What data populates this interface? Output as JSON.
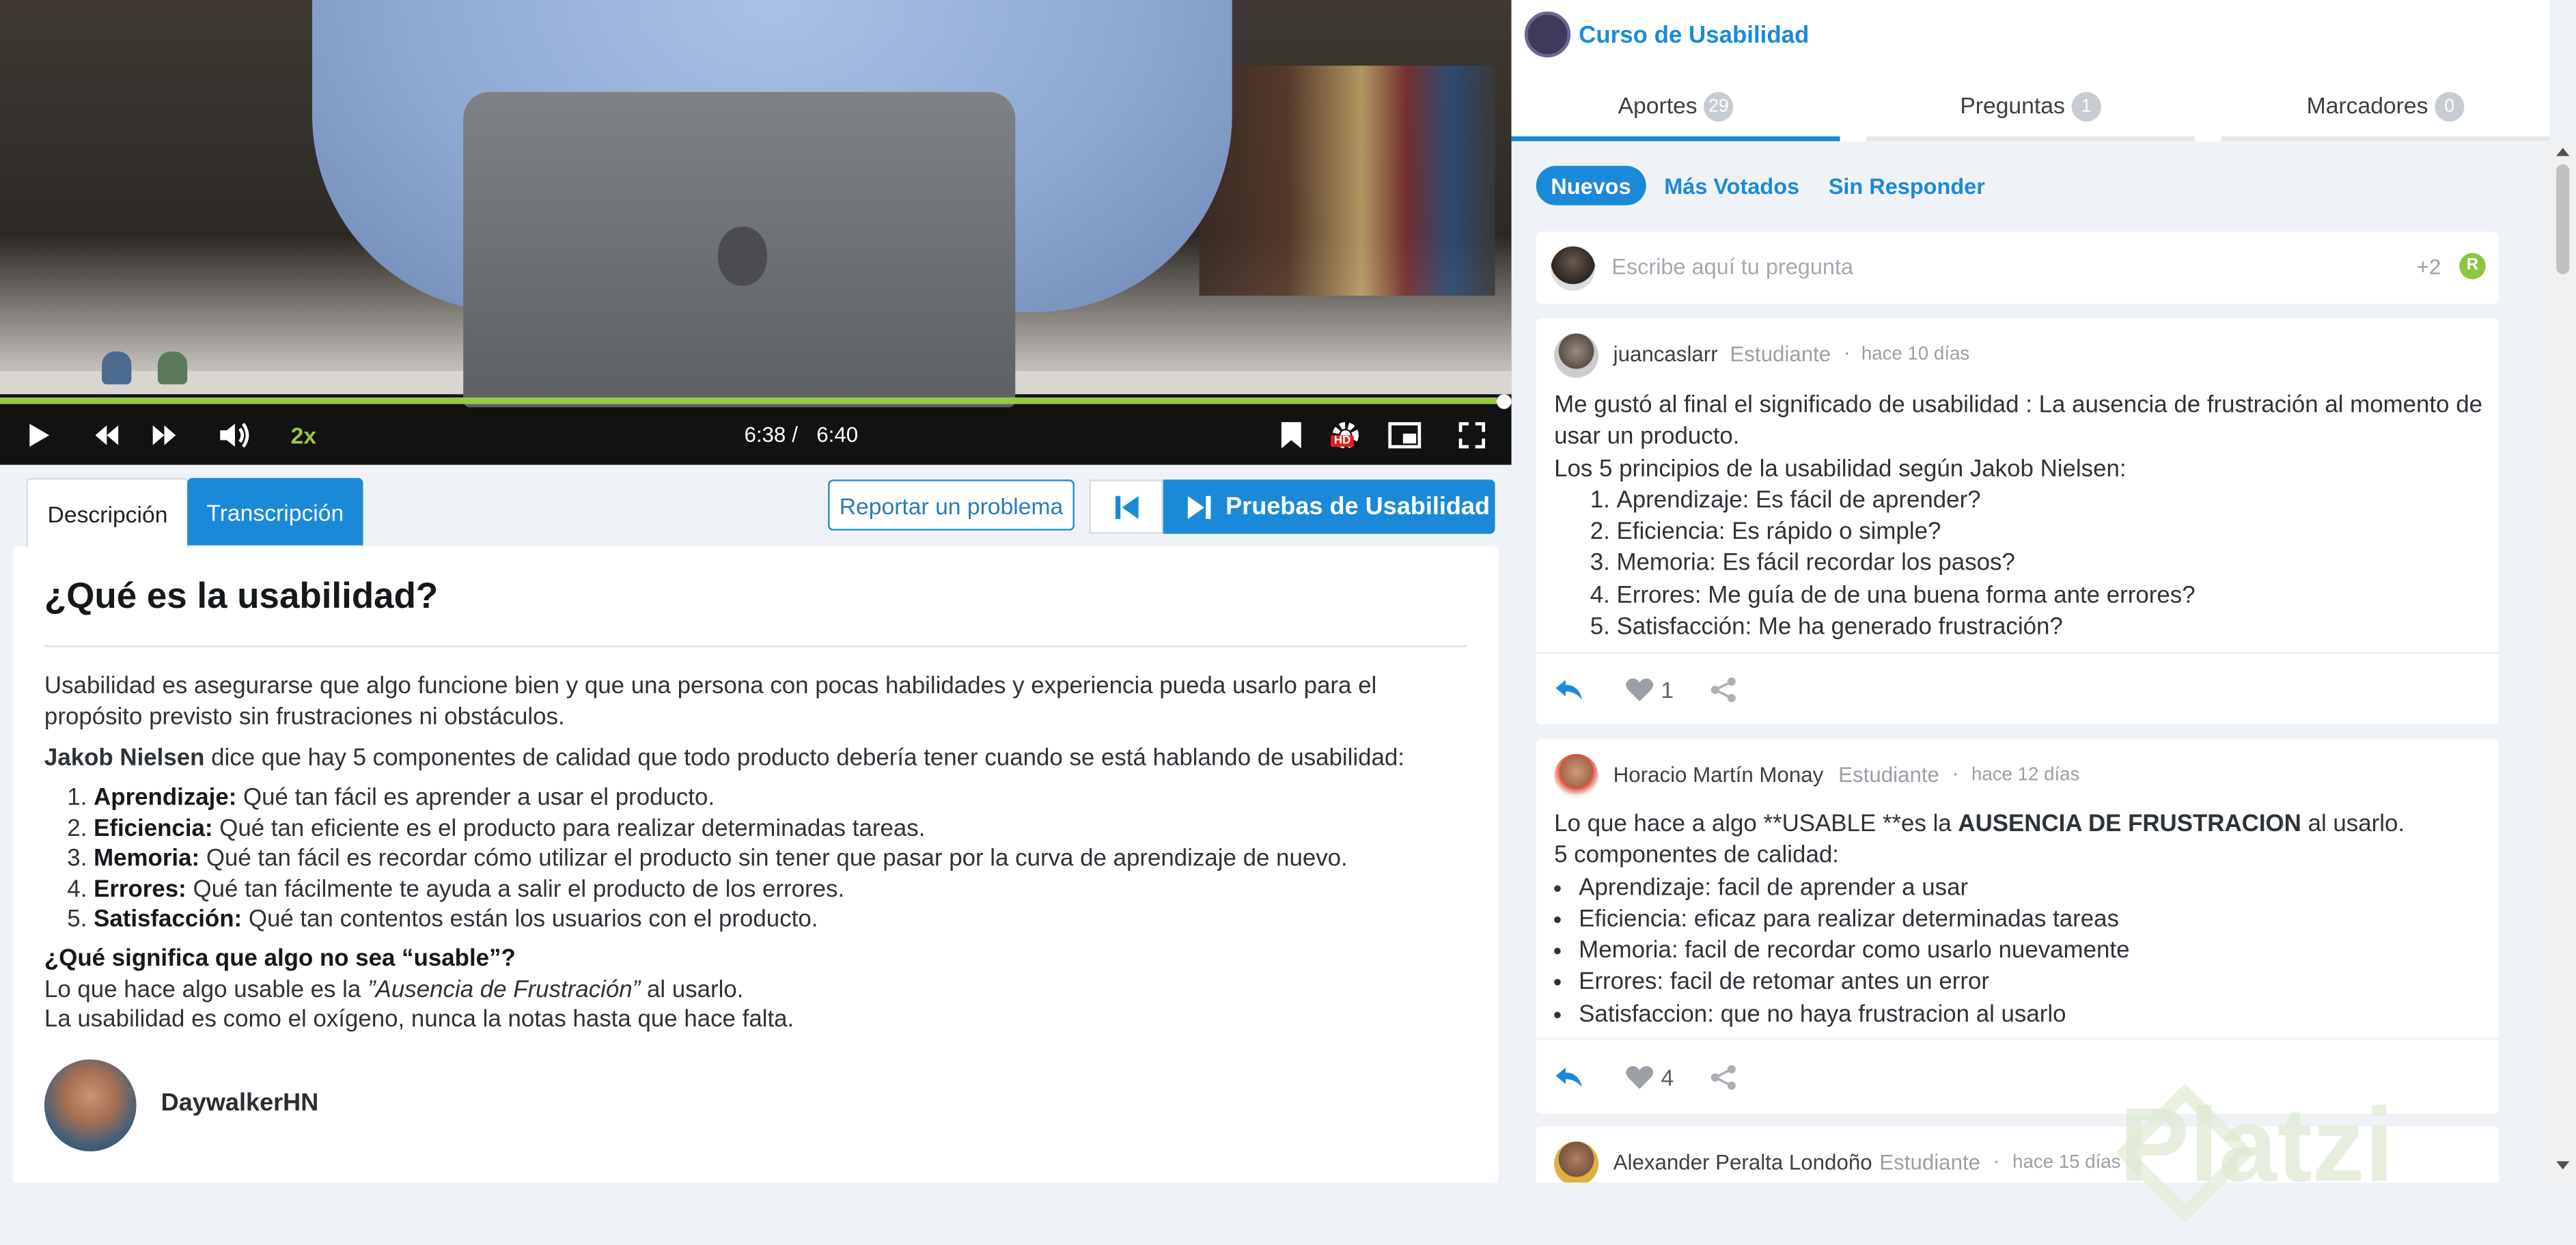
{
  "video": {
    "speed": "2x",
    "current_time": "6:38",
    "time_separator": "/",
    "duration": "6:40",
    "progress_fraction": 0.995,
    "hd_badge": "HD"
  },
  "lesson_tabs": {
    "description": "Descripción",
    "transcription": "Transcripción"
  },
  "toolbar": {
    "report_label": "Reportar un problema",
    "next_lesson_label": "Pruebas de Usabilidad"
  },
  "content": {
    "title": "¿Qué es la usabilidad?",
    "intro": "Usabilidad es asegurarse que algo funcione bien y que una persona con pocas habilidades y experiencia pueda usarlo para el propósito previsto sin frustraciones ni obstáculos.",
    "nielsen_name": "Jakob Nielsen",
    "nielsen_text": " dice que hay 5 componentes de calidad que todo producto debería tener cuando se está hablando de usabilidad:",
    "components": [
      {
        "term": "Aprendizaje:",
        "desc": " Qué tan fácil es aprender a usar el producto."
      },
      {
        "term": "Eficiencia:",
        "desc": " Qué tan eficiente es el producto para realizar determinadas tareas."
      },
      {
        "term": "Memoria:",
        "desc": " Qué tan fácil es recordar cómo utilizar el producto sin tener que pasar por la curva de aprendizaje de nuevo."
      },
      {
        "term": "Errores:",
        "desc": " Qué tan fácilmente te ayuda a salir el producto de los errores."
      },
      {
        "term": "Satisfacción:",
        "desc": " Qué tan contentos están los usuarios con el producto."
      }
    ],
    "question_heading": "¿Qué significa que algo no sea “usable”?",
    "usable_prefix": "Lo que hace algo usable es la ",
    "usable_em": "”Ausencia de Frustración”",
    "usable_suffix": " al usarlo.",
    "oxygen_line": "La usabilidad es como el oxígeno, nunca la notas hasta que hace falta.",
    "author": "DaywalkerHN"
  },
  "course": {
    "title": "Curso de Usabilidad"
  },
  "right_tabs": [
    {
      "label": "Aportes",
      "count": "29"
    },
    {
      "label": "Preguntas",
      "count": "1"
    },
    {
      "label": "Marcadores",
      "count": "0"
    }
  ],
  "filters": {
    "new": "Nuevos",
    "top": "Más Votados",
    "unanswered": "Sin Responder"
  },
  "ask": {
    "placeholder": "Escribe aquí tu pregunta",
    "points": "+2",
    "badge": "R"
  },
  "posts": [
    {
      "user": "juancaslarr",
      "role": "Estudiante",
      "date": "hace 10 días",
      "lines": [
        "Me gustó al final el significado de usabilidad : La ausencia de frustración al momento de usar un producto.",
        "Los 5 principios de la usabilidad según Jakob Nielsen:"
      ],
      "items": [
        "Aprendizaje: Es fácil de aprender?",
        "Eficiencia: Es rápido o simple?",
        "Memoria: Es fácil recordar los pasos?",
        "Errores: Me guía de de una buena forma ante errores?",
        "Satisfacción: Me ha generado frustración?"
      ],
      "likes": "1"
    },
    {
      "user": "Horacio Martín Monay",
      "role": "Estudiante",
      "date": "hace 12 días",
      "intro_prefix": "Lo que hace a algo **USABLE **es la ",
      "intro_bold": "AUSENCIA DE FRUSTRACION",
      "intro_suffix": " al usarlo.",
      "subheading": "5 componentes de calidad:",
      "items": [
        "Aprendizaje: facil de aprender a usar",
        "Eficiencia: eficaz para realizar determinadas tareas",
        "Memoria: facil de recordar como usarlo nuevamente",
        "Errores: facil de retomar antes un error",
        "Satisfaccion: que no haya frustracion al usarlo"
      ],
      "likes": "4"
    },
    {
      "user": "Alexander Peralta Londoño",
      "role": "Estudiante",
      "date": "hace 15 días"
    }
  ],
  "watermark": "Platzi",
  "colors": {
    "accent": "#1a8ad8",
    "progress": "#98ca3f",
    "badge_green": "#8cc63f"
  }
}
